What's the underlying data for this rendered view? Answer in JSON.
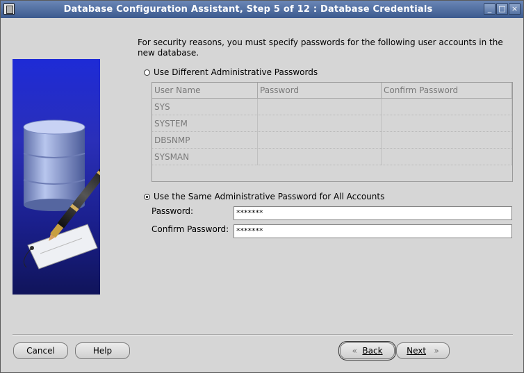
{
  "window": {
    "title": "Database Configuration Assistant, Step 5 of 12 : Database Credentials",
    "minimize_glyph": "_",
    "maximize_glyph": "□",
    "close_glyph": "×"
  },
  "intro_text": "For security reasons, you must specify passwords for the following user accounts in the new database.",
  "option_different": {
    "label": "Use Different Administrative Passwords",
    "selected": false
  },
  "accounts_table": {
    "columns": [
      "User Name",
      "Password",
      "Confirm Password"
    ],
    "rows": [
      {
        "user": "SYS",
        "password": "",
        "confirm": ""
      },
      {
        "user": "SYSTEM",
        "password": "",
        "confirm": ""
      },
      {
        "user": "DBSNMP",
        "password": "",
        "confirm": ""
      },
      {
        "user": "SYSMAN",
        "password": "",
        "confirm": ""
      }
    ]
  },
  "option_same": {
    "label": "Use the Same Administrative Password for All Accounts",
    "selected": true
  },
  "password": {
    "label": "Password:",
    "value": "*******"
  },
  "confirm_password": {
    "label": "Confirm Password:",
    "value": "*******"
  },
  "buttons": {
    "cancel": "Cancel",
    "help": "Help",
    "back": "Back",
    "next": "Next",
    "back_glyph": "«",
    "next_glyph": "»"
  },
  "icons": {
    "app": "database-window-icon",
    "illustration": "database-pen-illustration"
  }
}
